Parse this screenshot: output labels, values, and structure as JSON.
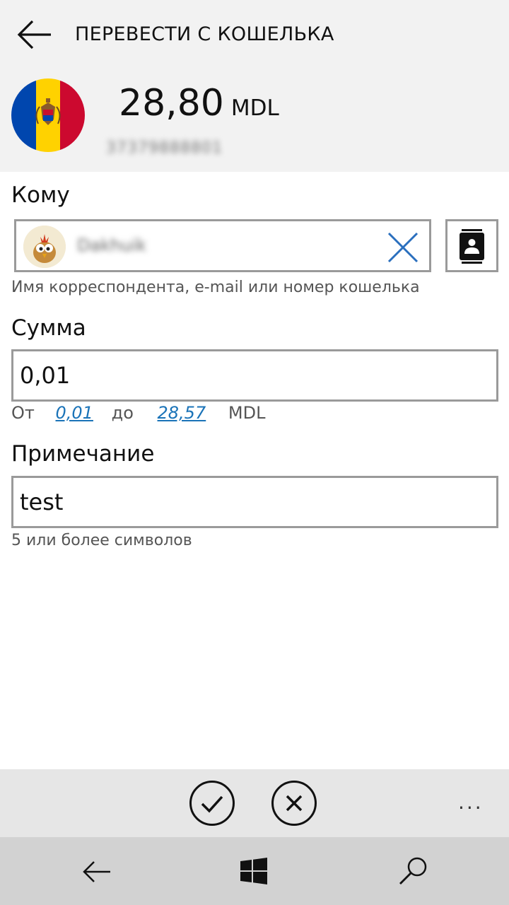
{
  "header": {
    "title": "ПЕРЕВЕСТИ С КОШЕЛЬКА",
    "balance_amount": "28,80",
    "balance_currency": "MDL",
    "wallet_number": "37379888801"
  },
  "recipient": {
    "label": "Кому",
    "value": "Dakhuik",
    "hint": "Имя корреспондента, e-mail или номер кошелька"
  },
  "amount": {
    "label": "Сумма",
    "value": "0,01",
    "range_from_label": "От",
    "range_min": "0,01",
    "range_to_label": "до",
    "range_max": "28,57",
    "currency": "MDL"
  },
  "note": {
    "label": "Примечание",
    "value": "test",
    "hint": "5 или более символов"
  },
  "app_bar": {
    "more": "..."
  },
  "colors": {
    "link": "#1a73b8",
    "clear_icon": "#2a6fbe",
    "header_bg": "#f2f2f2",
    "app_bar_bg": "#e6e6e6",
    "nav_bar_bg": "#d2d2d2"
  }
}
